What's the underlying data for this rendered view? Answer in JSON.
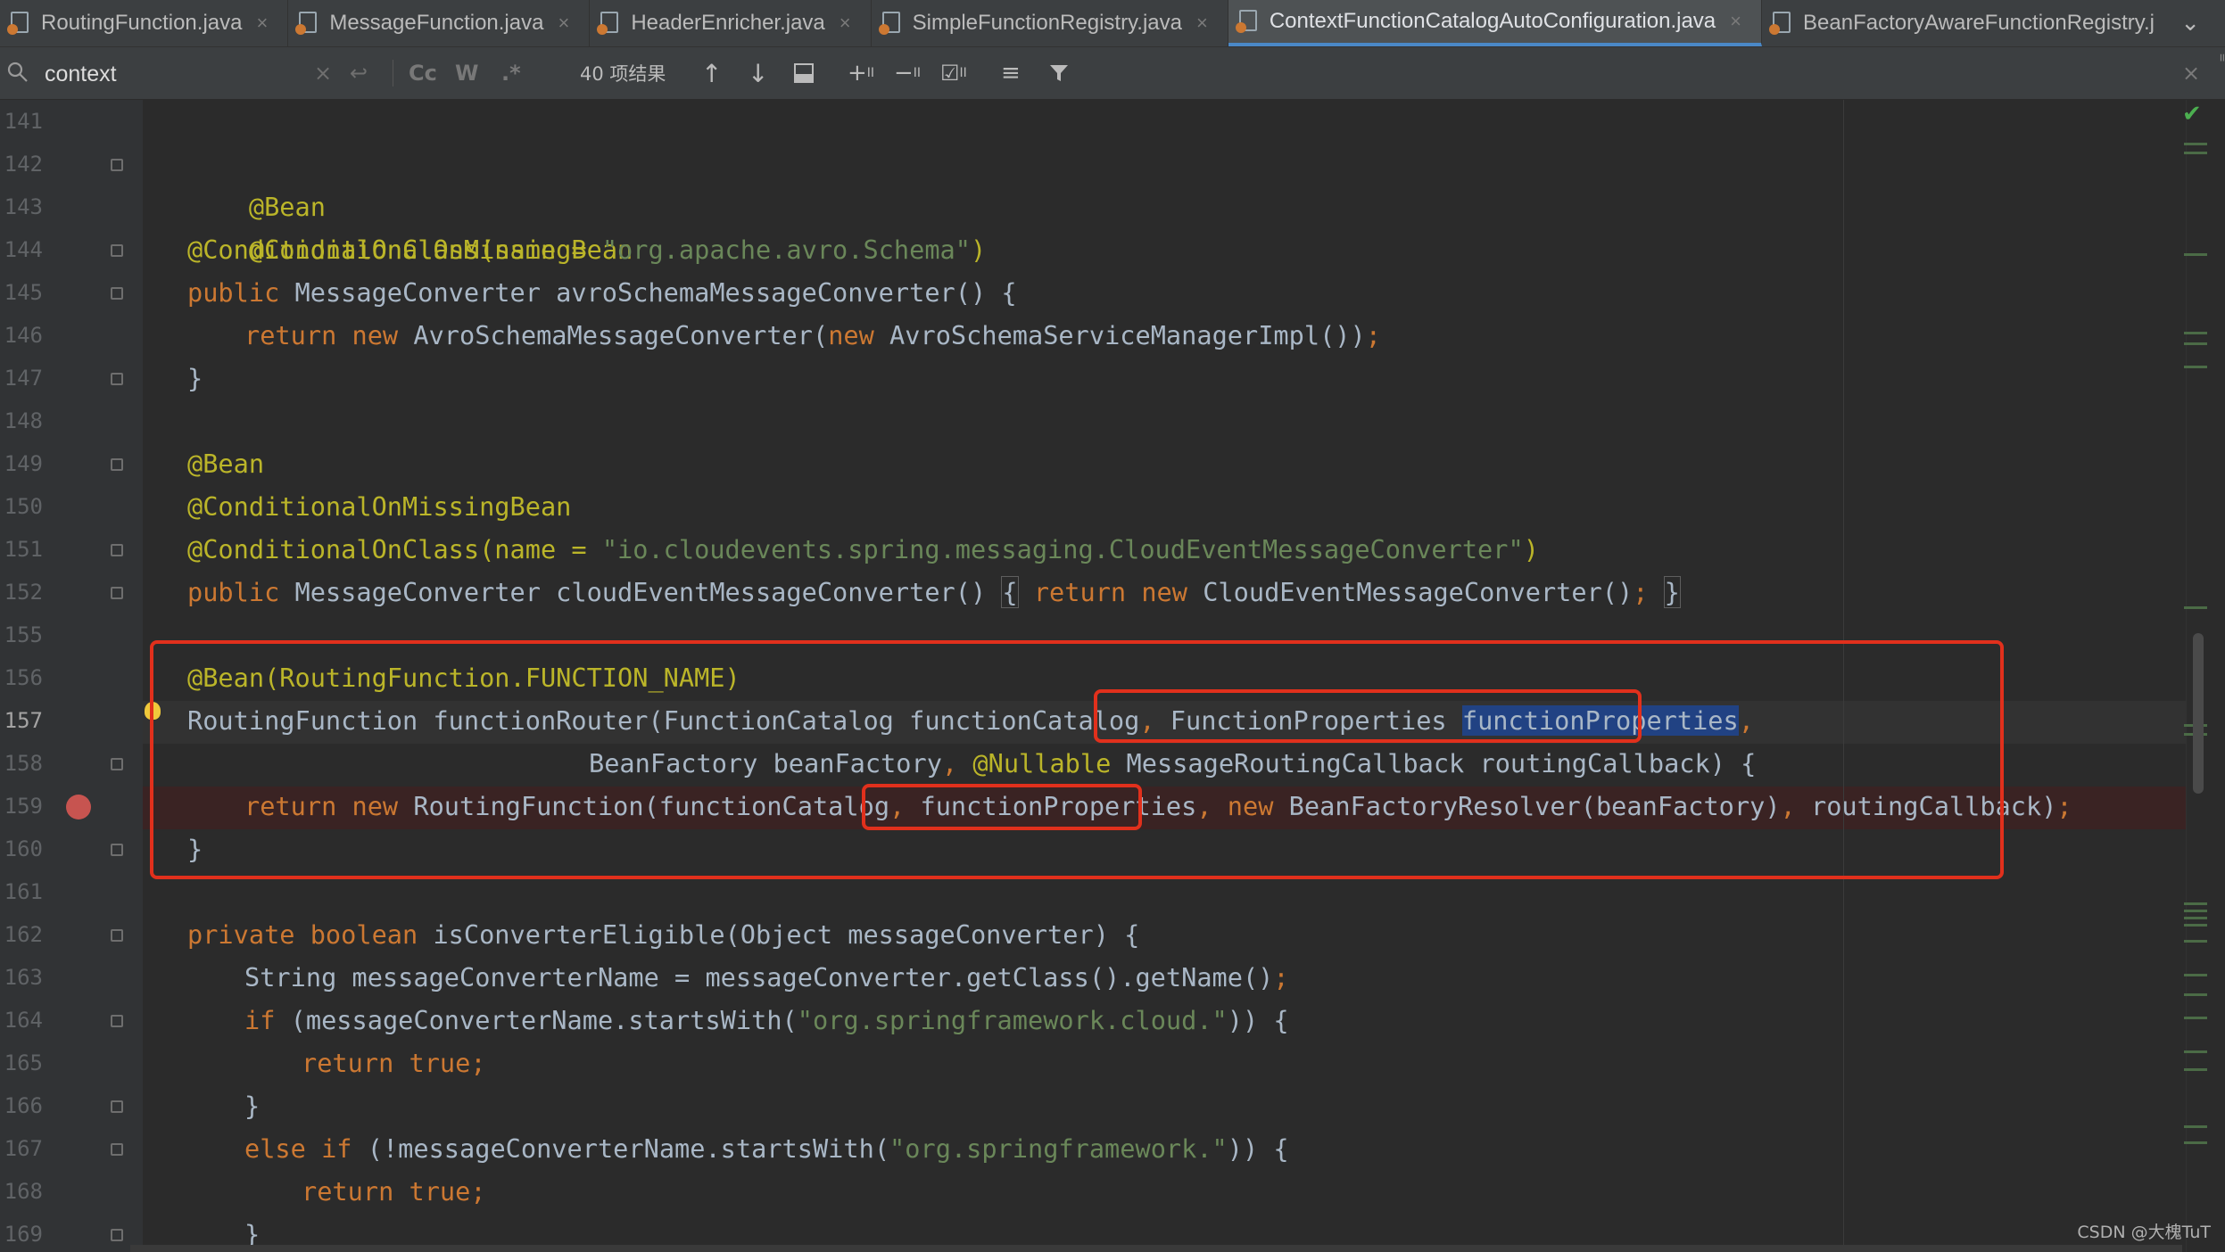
{
  "tabs": [
    {
      "label": "RoutingFunction.java",
      "active": false
    },
    {
      "label": "MessageFunction.java",
      "active": false
    },
    {
      "label": "HeaderEnricher.java",
      "active": false
    },
    {
      "label": "SimpleFunctionRegistry.java",
      "active": false
    },
    {
      "label": "ContextFunctionCatalogAutoConfiguration.java",
      "active": true
    },
    {
      "label": "BeanFactoryAwareFunctionRegistry.j",
      "active": false
    }
  ],
  "find": {
    "query": "context",
    "options": [
      "Cc",
      "W",
      ".*"
    ],
    "match_count": "40 项结果"
  },
  "line_numbers": [
    "141",
    "142",
    "143",
    "144",
    "145",
    "146",
    "147",
    "148",
    "149",
    "150",
    "151",
    "152",
    "155",
    "156",
    "157",
    "158",
    "159",
    "160",
    "161",
    "162",
    "163",
    "164",
    "165",
    "166",
    "167",
    "168",
    "169"
  ],
  "current_line": "157",
  "breakpoint_line": "159",
  "code": {
    "l142": "@Bean",
    "l143": "@ConditionalOnMissingBean",
    "l144_a": "@ConditionalOnClass(name = ",
    "l144_s": "\"org.apache.avro.Schema\"",
    "l144_b": ")",
    "l145_k": "public",
    "l145_r": " MessageConverter avroSchemaMessageConverter() {",
    "l146_k1": "return new",
    "l146_a": " AvroSchemaMessageConverter(",
    "l146_k2": "new",
    "l146_b": " AvroSchemaServiceManagerImpl())",
    "l146_semi": ";",
    "l147": "}",
    "l149": "@Bean",
    "l150": "@ConditionalOnMissingBean",
    "l151_a": "@ConditionalOnClass(name = ",
    "l151_s": "\"io.cloudevents.spring.messaging.CloudEventMessageConverter\"",
    "l151_b": ")",
    "l152_k": "public",
    "l152_a": " MessageConverter cloudEventMessageConverter() ",
    "l152_brace_open": "{",
    "l152_k2": " return new",
    "l152_b": " CloudEventMessageConverter()",
    "l152_semi": ";",
    "l152_brace_close": "}",
    "l156": "@Bean(RoutingFunction.FUNCTION_NAME)",
    "l157_a": "RoutingFunction functionRouter(FunctionCatalog functionCatalog",
    "l157_c1": ",",
    "l157_b": " FunctionProperties ",
    "l157_hl": "functionProperties",
    "l157_c2": ",",
    "l158_a": "BeanFactory beanFactory",
    "l158_c": ",",
    "l158_ann": " @Nullable",
    "l158_b": " MessageRoutingCallback routingCallback) {",
    "l159_k": "return new",
    "l159_a": " RoutingFunction(functionCatalog",
    "l159_c1": ",",
    "l159_b": " functionProperties",
    "l159_c2": ",",
    "l159_k2": " new",
    "l159_c": " BeanFactoryResolver(beanFactory)",
    "l159_c3": ",",
    "l159_d": " routingCallback)",
    "l159_semi": ";",
    "l160": "}",
    "l162_k": "private boolean",
    "l162_r": " isConverterEligible(Object messageConverter) {",
    "l163_a": "String messageConverterName = messageConverter.getClass().getName()",
    "l163_semi": ";",
    "l164_k": "if",
    "l164_a": " (messageConverterName.startsWith(",
    "l164_s": "\"org.springframework.cloud.\"",
    "l164_b": ")) {",
    "l165_k": "return true",
    "l165_semi": ";",
    "l166": "}",
    "l167_k": "else if",
    "l167_a": " (!messageConverterName.startsWith(",
    "l167_s": "\"org.springframework.\"",
    "l167_b": ")) {",
    "l168_k": "return true",
    "l168_semi": ";",
    "l169": "}"
  },
  "watermark": "CSDN @大槐TuT",
  "colors": {
    "editor_bg": "#2b2b2b",
    "keyword": "#cc7832",
    "string": "#6a8759",
    "annotation": "#bbb529",
    "highlight_box": "#e1301c",
    "selection": "#214283",
    "breakpoint": "#c75450"
  }
}
